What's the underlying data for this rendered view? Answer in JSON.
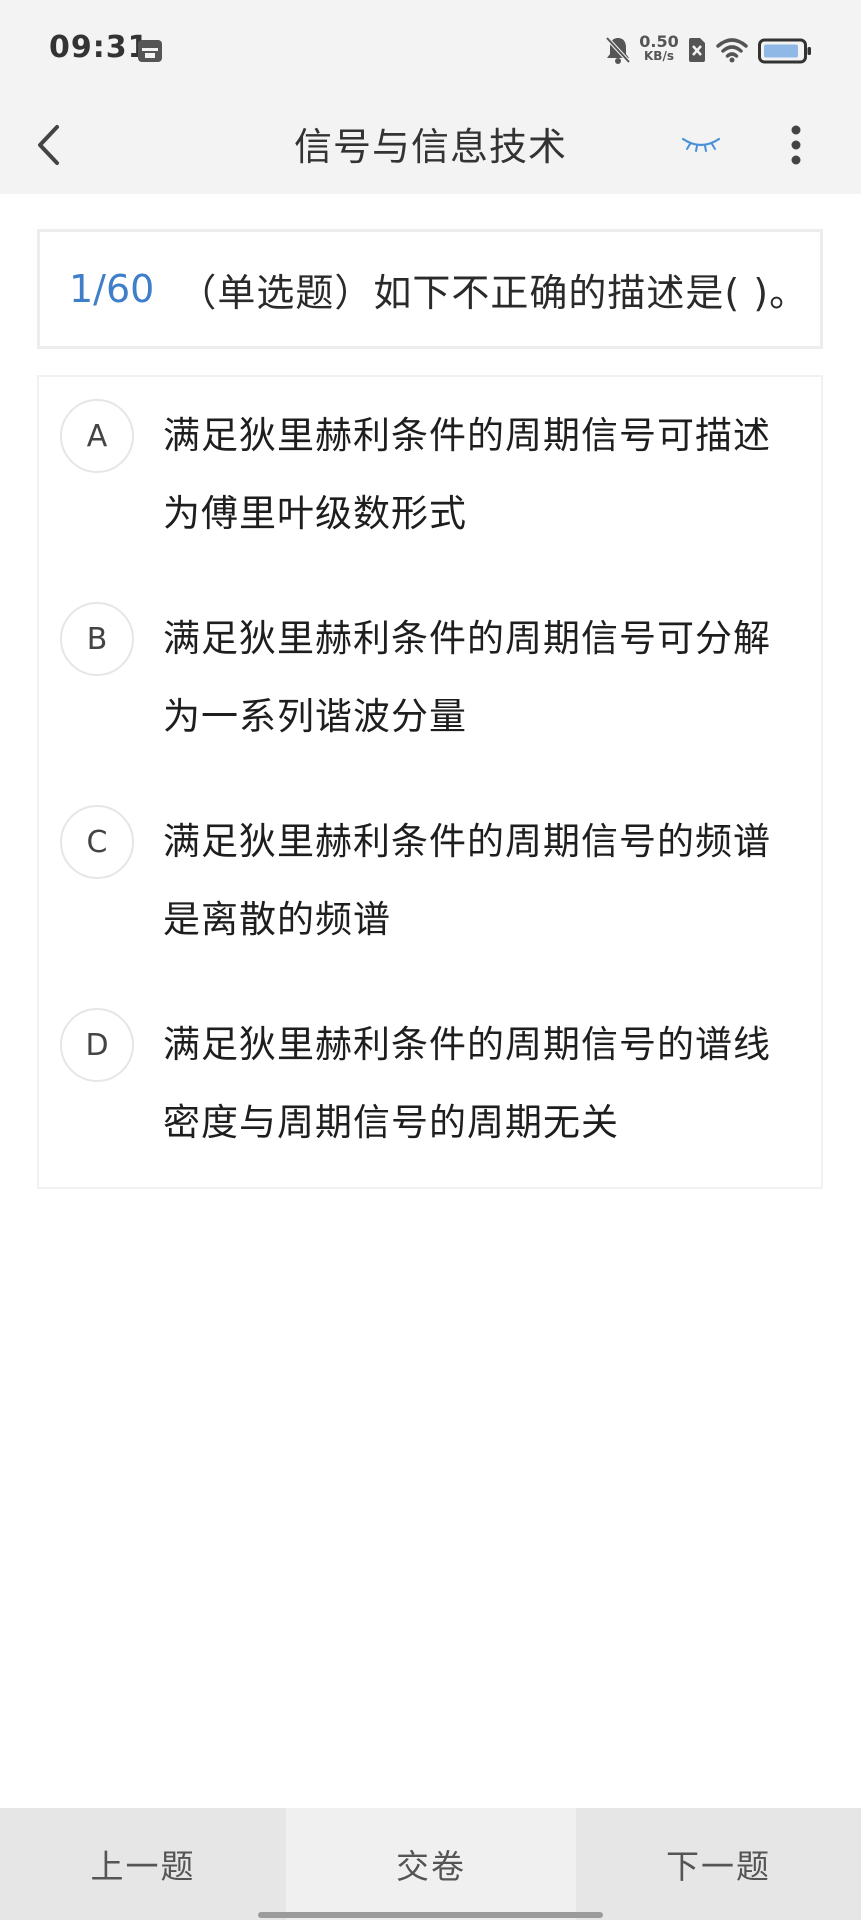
{
  "status_bar": {
    "time": "09:31",
    "net_speed_value": "0.50",
    "net_speed_unit": "KB/s",
    "icons": [
      "calendar-icon",
      "mute-bell-icon",
      "sim-off-icon",
      "wifi-icon",
      "battery-icon"
    ]
  },
  "header": {
    "title": "信号与信息技术",
    "back_icon": "chevron-left-icon",
    "eye_icon": "eye-closed-icon",
    "more_icon": "more-vertical-icon"
  },
  "question": {
    "index": "1/60",
    "text": "（单选题）如下不正确的描述是( )。"
  },
  "options": [
    {
      "letter": "A",
      "text": "满足狄里赫利条件的周期信号可描述为傅里叶级数形式"
    },
    {
      "letter": "B",
      "text": "满足狄里赫利条件的周期信号可分解为一系列谐波分量"
    },
    {
      "letter": "C",
      "text": "满足狄里赫利条件的周期信号的频谱是离散的频谱"
    },
    {
      "letter": "D",
      "text": "满足狄里赫利条件的周期信号的谱线密度与周期信号的周期无关"
    }
  ],
  "bottom": {
    "prev_label": "上一题",
    "submit_label": "交卷",
    "next_label": "下一题"
  },
  "colors": {
    "accent": "#3f7fc9",
    "eye_icon": "#4a90d9",
    "header_bg": "#f3f3f3",
    "bottom_bar_bg": "#e6e6e6"
  }
}
